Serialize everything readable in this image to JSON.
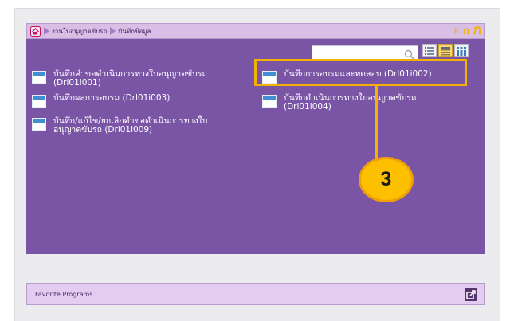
{
  "breadcrumb": {
    "items": [
      "งานใบอนุญาตขับรถ",
      "บันทึกข้อมูล"
    ]
  },
  "font_size_controls": [
    "ก",
    "ก",
    "ก"
  ],
  "search": {
    "value": "",
    "placeholder": ""
  },
  "programs": {
    "left": [
      {
        "label_line1": "บันทึกคำขอดำเนินการทางใบอนุญาตขับรถ",
        "label_line2": "(Drl01i001)"
      },
      {
        "label_line1": "บันทึกผลการอบรม (Drl01i003)",
        "label_line2": ""
      },
      {
        "label_line1": "บันทึก/แก้ไข/ยกเลิกคำขอดำเนินการทางใบ",
        "label_line2": "อนุญาตขับรถ (Drl01i009)"
      }
    ],
    "right": [
      {
        "label_line1": "บันทึกการอบรมและทดสอบ (Drl01i002)",
        "label_line2": ""
      },
      {
        "label_line1": "บันทึกดำเนินการทางใบอนุญาตขับรถ",
        "label_line2": "(Drl01i004)"
      }
    ]
  },
  "callout": {
    "number": "3"
  },
  "favorites": {
    "label": "Favorite Programs"
  },
  "colors": {
    "panel": "#7a55a6",
    "highlight": "#f5b100",
    "callout": "#fdc000",
    "breadcrumb_bar": "#d9bfe6"
  },
  "icons": [
    "home-icon",
    "search-icon",
    "list-view-icon",
    "detail-view-icon",
    "grid-view-icon",
    "program-window-icon",
    "open-external-icon"
  ]
}
